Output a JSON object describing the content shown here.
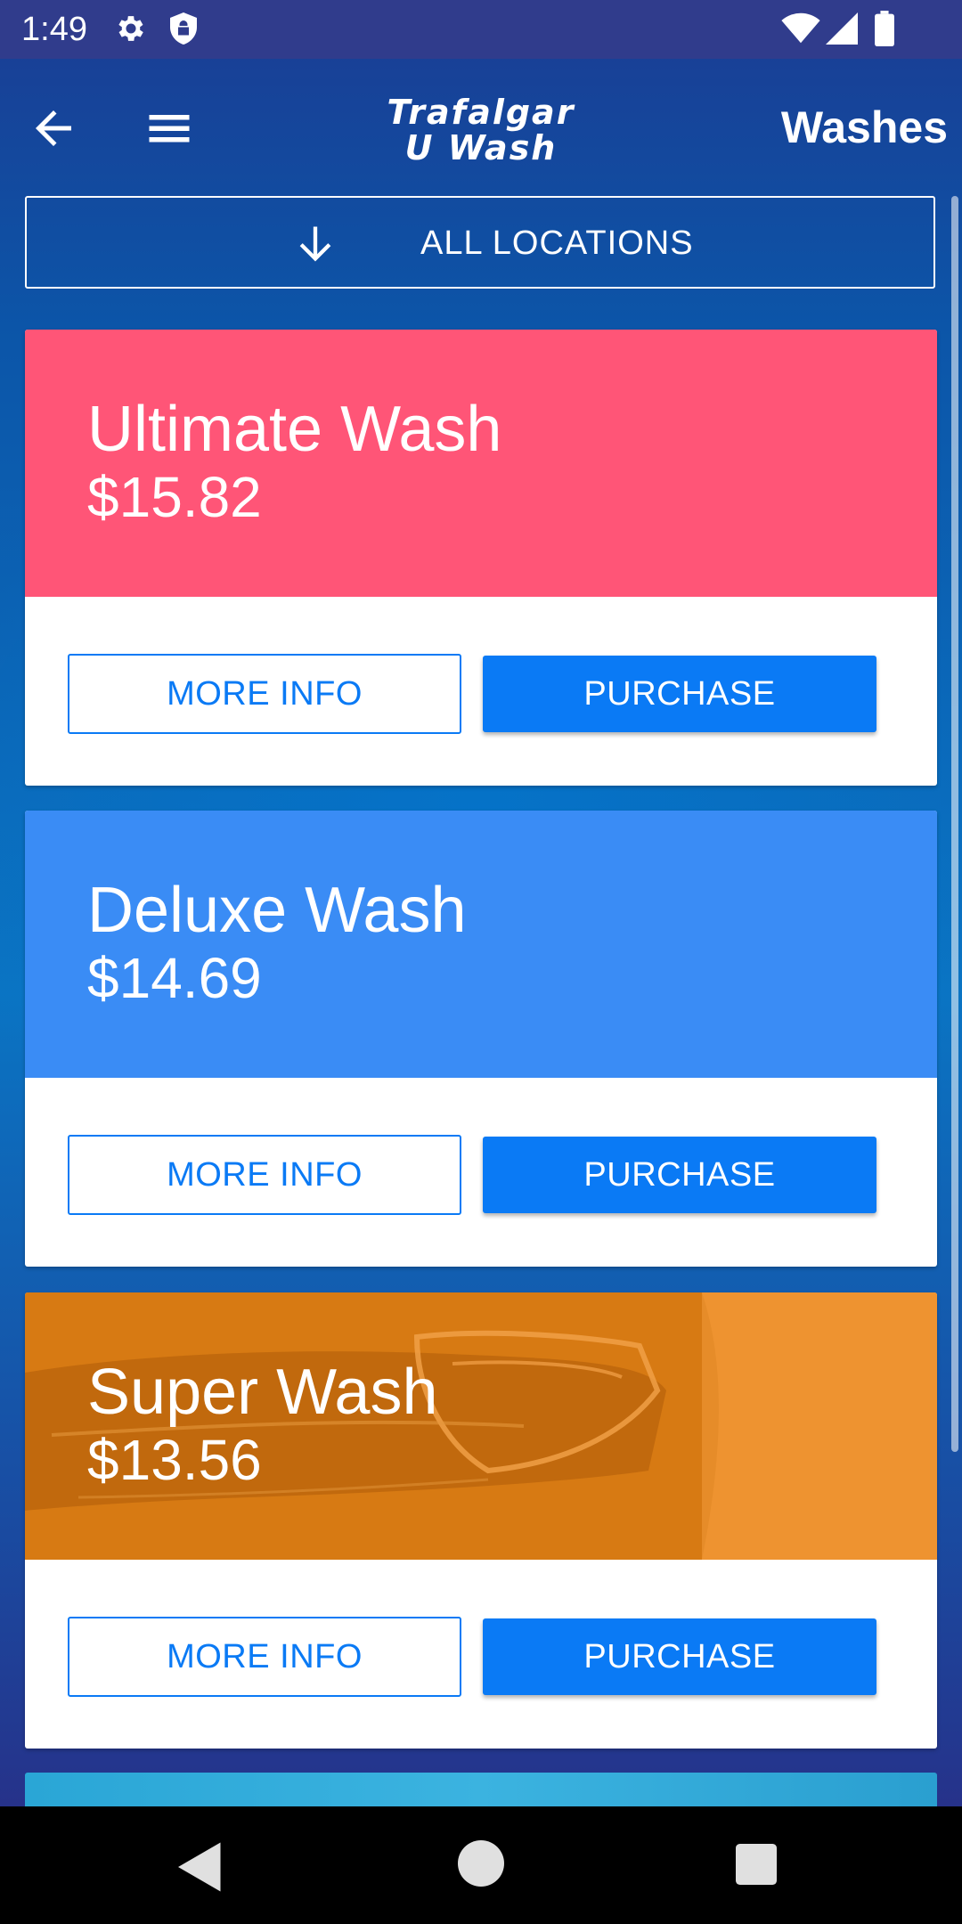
{
  "status_bar": {
    "time": "1:49",
    "icons": [
      "gear-icon",
      "shield-icon",
      "wifi-icon",
      "signal-icon",
      "battery-icon"
    ]
  },
  "app_bar": {
    "brand_line1": "Trafalgar",
    "brand_line2": "U Wash",
    "title": "Washes",
    "icons": [
      "back-arrow-icon",
      "hamburger-menu-icon"
    ]
  },
  "filter": {
    "label": "ALL LOCATIONS",
    "icon": "arrow-down-icon"
  },
  "washes": [
    {
      "name": "Ultimate Wash",
      "price": "$15.82",
      "color": "#ff5577",
      "more_info_label": "MORE INFO",
      "purchase_label": "PURCHASE"
    },
    {
      "name": "Deluxe Wash",
      "price": "$14.69",
      "color": "#3a8cf5",
      "more_info_label": "MORE INFO",
      "purchase_label": "PURCHASE"
    },
    {
      "name": "Super Wash",
      "price": "$13.56",
      "color": "#e98b22",
      "more_info_label": "MORE INFO",
      "purchase_label": "PURCHASE"
    }
  ],
  "colors": {
    "accent": "#0a7af5",
    "status_bar": "#303c8c",
    "next_card": "#33ade0"
  },
  "nav_bar": {
    "icons": [
      "nav-back-icon",
      "nav-home-icon",
      "nav-recents-icon"
    ]
  }
}
